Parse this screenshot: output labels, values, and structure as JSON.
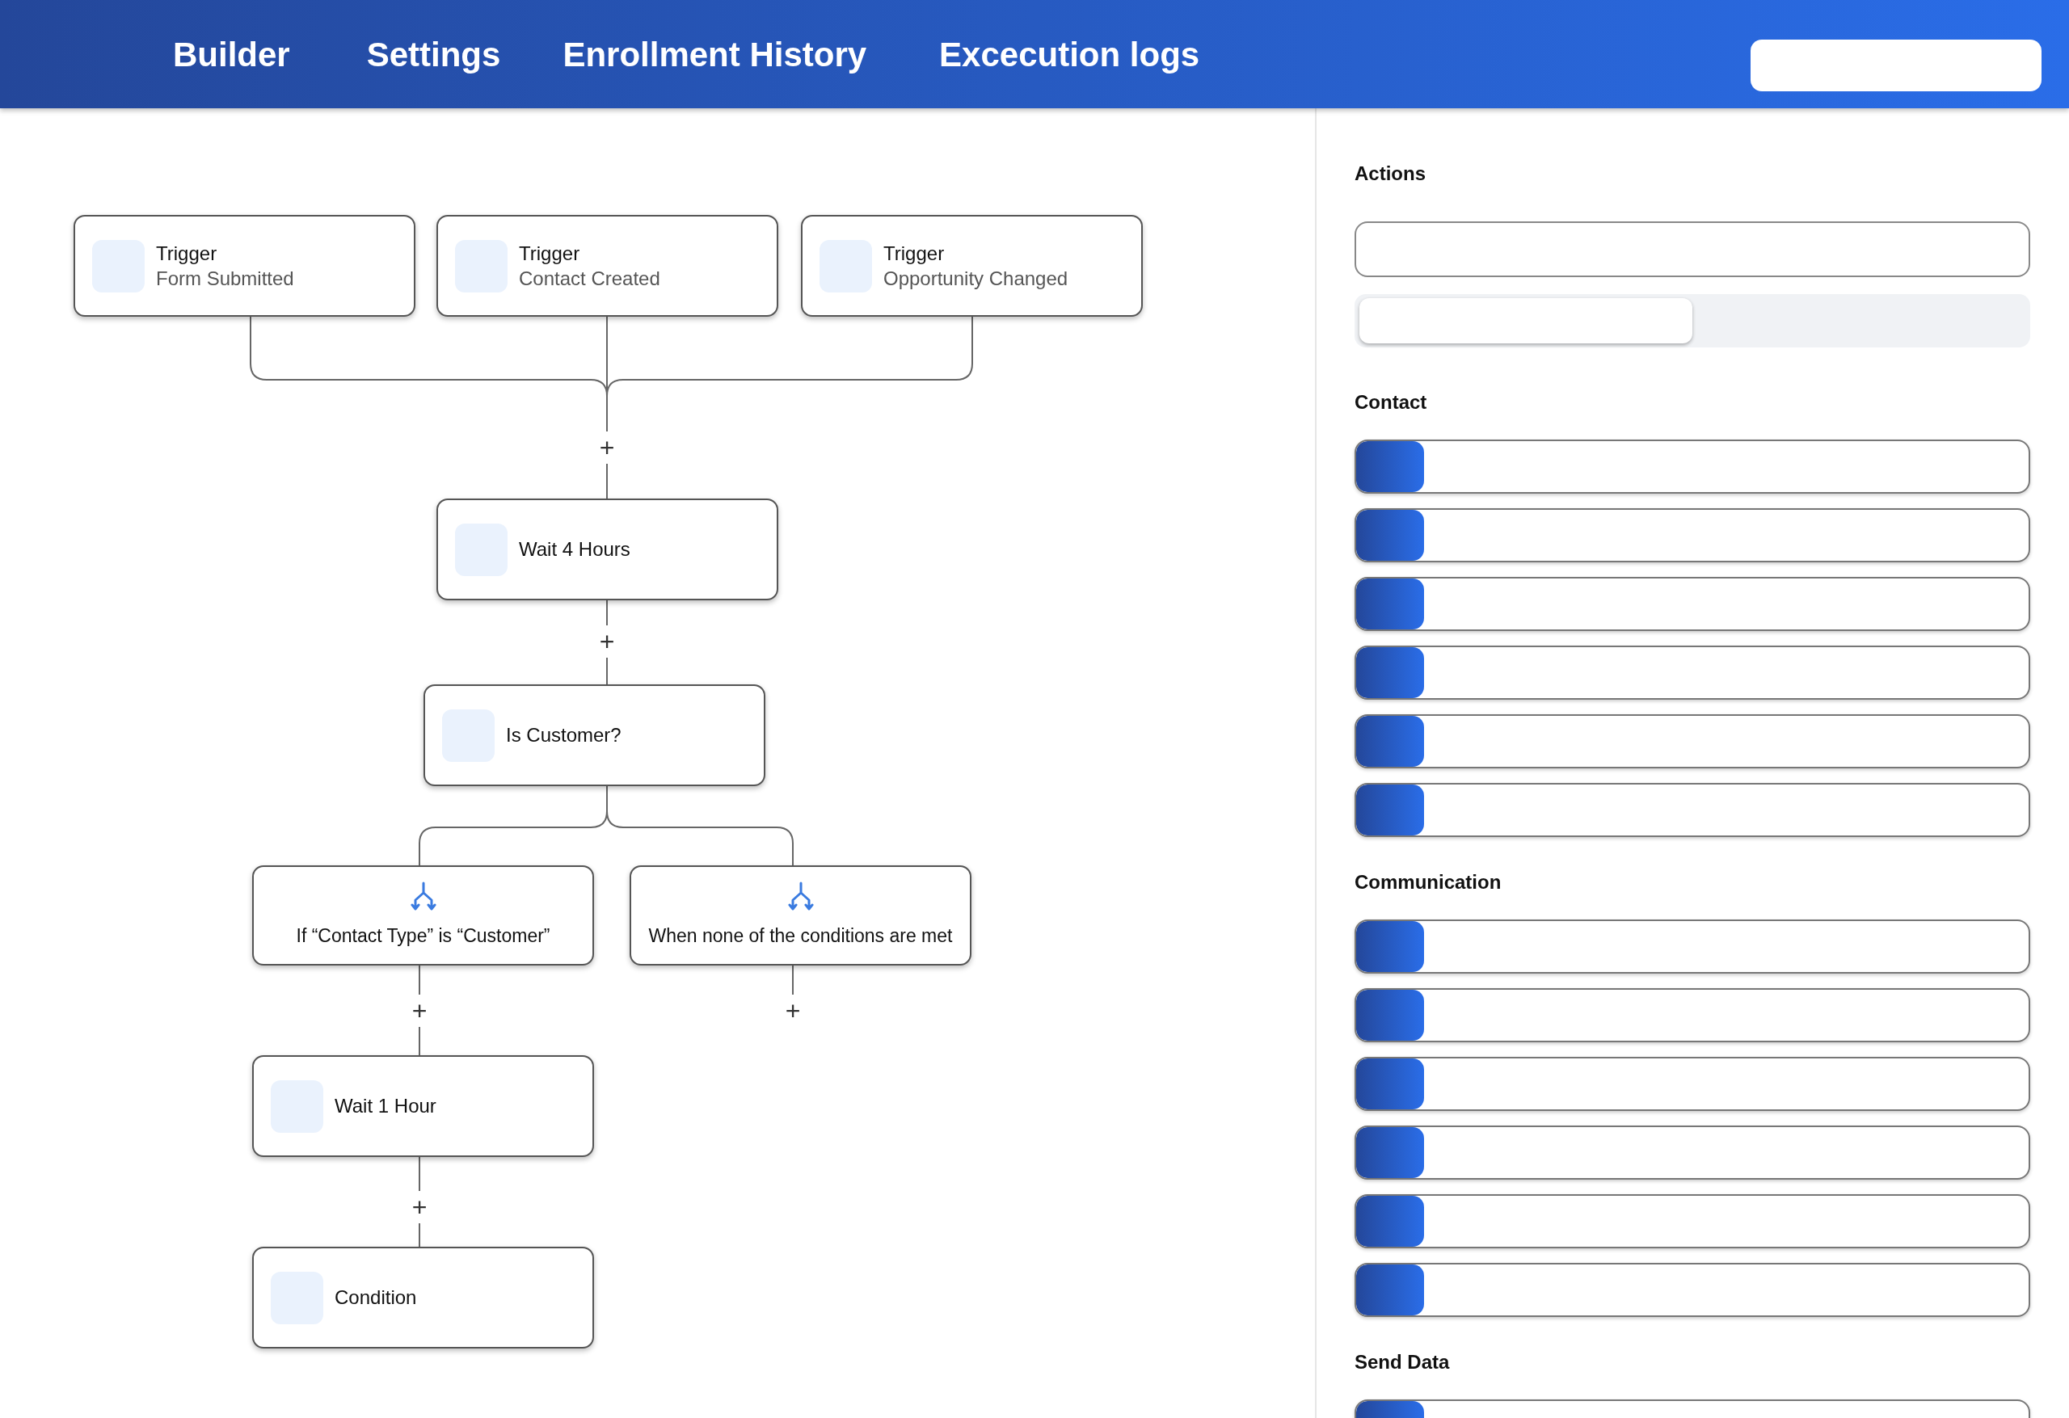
{
  "tabs": [
    {
      "label": "Builder"
    },
    {
      "label": "Settings"
    },
    {
      "label": "Enrollment History"
    },
    {
      "label": "Excecution logs"
    }
  ],
  "flow": {
    "nodes": [
      {
        "kind": "trigger",
        "title": "Trigger",
        "subtitle": "Form Submitted"
      },
      {
        "kind": "trigger",
        "title": "Trigger",
        "subtitle": "Contact Created"
      },
      {
        "kind": "trigger",
        "title": "Trigger",
        "subtitle": "Opportunity Changed"
      },
      {
        "kind": "step",
        "title": "Wait 4 Hours"
      },
      {
        "kind": "step",
        "title": "Is Customer?"
      },
      {
        "kind": "branch",
        "title": "If “Contact Type” is “Customer”"
      },
      {
        "kind": "branch",
        "title": "When none of the conditions are met"
      },
      {
        "kind": "step",
        "title": "Wait 1 Hour"
      },
      {
        "kind": "step",
        "title": "Condition"
      }
    ],
    "add_points": [
      "+",
      "+",
      "+",
      "+",
      "+"
    ]
  },
  "panel": {
    "title": "Actions",
    "segments": [
      {
        "selected": true
      },
      {
        "selected": false
      }
    ],
    "sections": [
      {
        "title": "Contact",
        "items": [
          {
            "kind": "action"
          },
          {
            "kind": "action"
          },
          {
            "kind": "action"
          },
          {
            "kind": "action"
          },
          {
            "kind": "action"
          },
          {
            "kind": "action"
          }
        ]
      },
      {
        "title": "Communication",
        "items": [
          {
            "kind": "action"
          },
          {
            "kind": "action"
          },
          {
            "kind": "action"
          },
          {
            "kind": "action"
          },
          {
            "kind": "action"
          },
          {
            "kind": "action"
          }
        ]
      },
      {
        "title": "Send Data",
        "items": [
          {
            "kind": "action"
          }
        ]
      }
    ]
  }
}
